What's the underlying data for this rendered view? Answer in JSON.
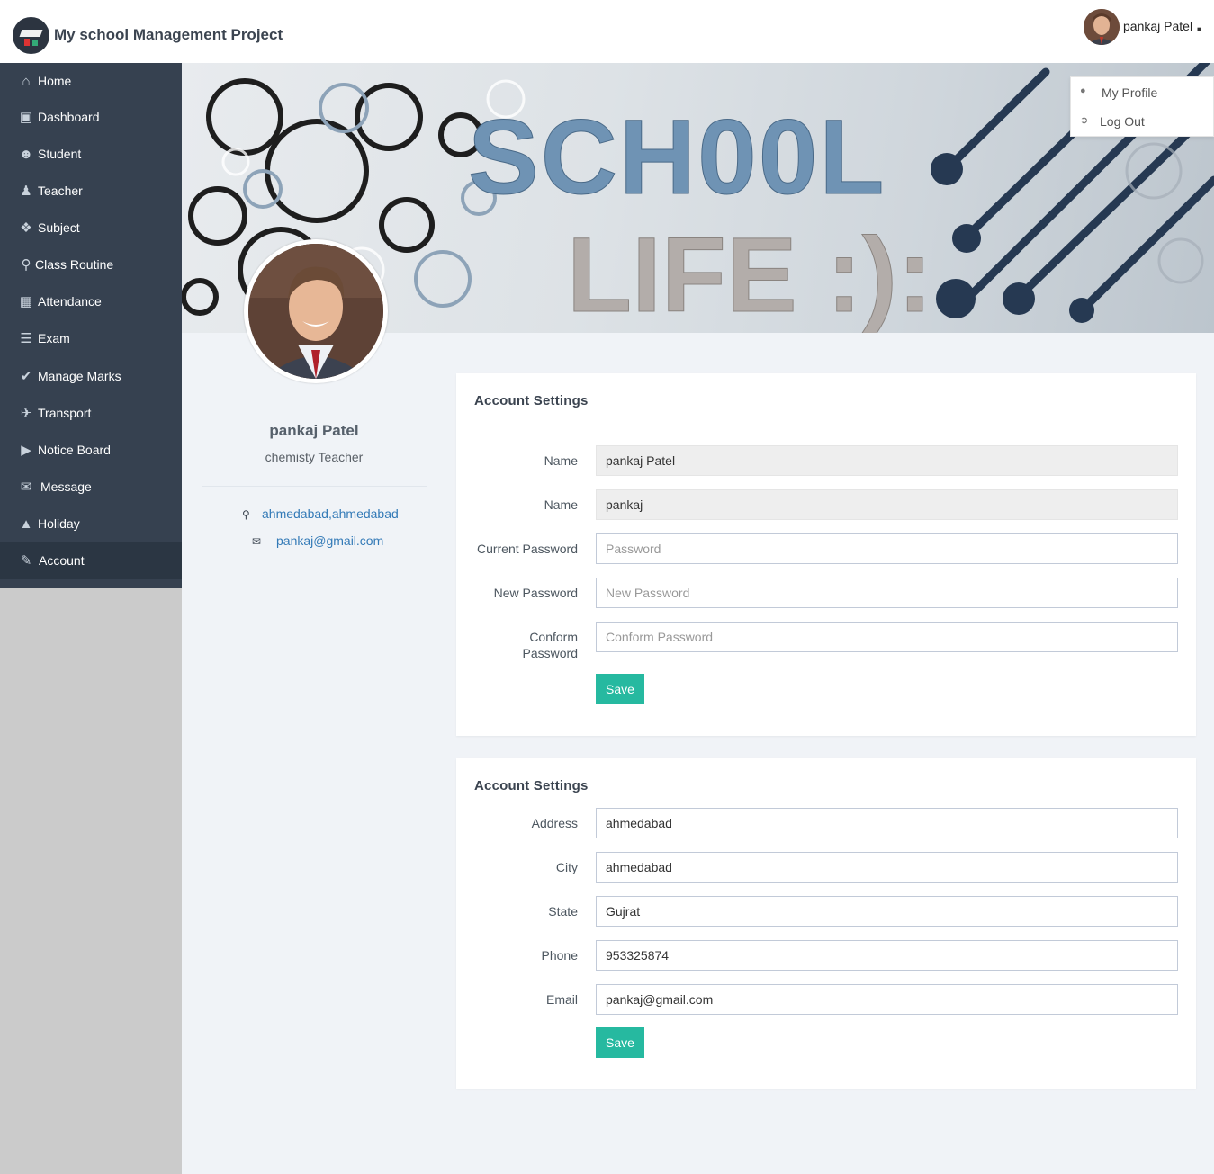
{
  "header": {
    "brand": "My school Management Project",
    "user_name": "pankaj Patel"
  },
  "sidebar": {
    "items": [
      {
        "label": "Home",
        "icon": "home-icon"
      },
      {
        "label": "Dashboard",
        "icon": "dashboard-icon"
      },
      {
        "label": "Student",
        "icon": "student-icon"
      },
      {
        "label": "Teacher",
        "icon": "teacher-icon"
      },
      {
        "label": "Subject",
        "icon": "subject-icon"
      },
      {
        "label": "Class Routine",
        "icon": "map-pin-icon"
      },
      {
        "label": "Attendance",
        "icon": "attendance-icon"
      },
      {
        "label": "Exam",
        "icon": "list-icon"
      },
      {
        "label": "Manage Marks",
        "icon": "check-circle-icon"
      },
      {
        "label": "Transport",
        "icon": "plane-icon"
      },
      {
        "label": "Notice Board",
        "icon": "megaphone-icon"
      },
      {
        "label": "Message",
        "icon": "envelope-icon"
      },
      {
        "label": "Holiday",
        "icon": "holiday-icon"
      },
      {
        "label": "Account",
        "icon": "pencil-icon",
        "active": true
      }
    ]
  },
  "dropdown": {
    "my_profile": "My Profile",
    "log_out": "Log Out"
  },
  "profile": {
    "name": "pankaj Patel",
    "role": "chemisty Teacher",
    "location": "ahmedabad,ahmedabad",
    "email": "pankaj@gmail.com"
  },
  "account_form": {
    "title": "Account Settings",
    "name_label": "Name",
    "name_value": "pankaj Patel",
    "username_label": "Name",
    "username_value": "pankaj",
    "current_password_label": "Current Password",
    "current_password_placeholder": "Password",
    "new_password_label": "New Password",
    "new_password_placeholder": "New Password",
    "confirm_password_label": "Conform Password",
    "confirm_password_placeholder": "Conform Password",
    "save_label": "Save"
  },
  "address_form": {
    "title": "Account Settings",
    "address_label": "Address",
    "address_value": "ahmedabad",
    "city_label": "City",
    "city_value": "ahmedabad",
    "state_label": "State",
    "state_value": "Gujrat",
    "phone_label": "Phone",
    "phone_value": "953325874",
    "email_label": "Email",
    "email_value": "pankaj@gmail.com",
    "save_label": "Save"
  },
  "colors": {
    "sidebar": "#364150",
    "sidebar_active": "#2b3643",
    "accent": "#26b9a0",
    "link": "#337ab7"
  }
}
